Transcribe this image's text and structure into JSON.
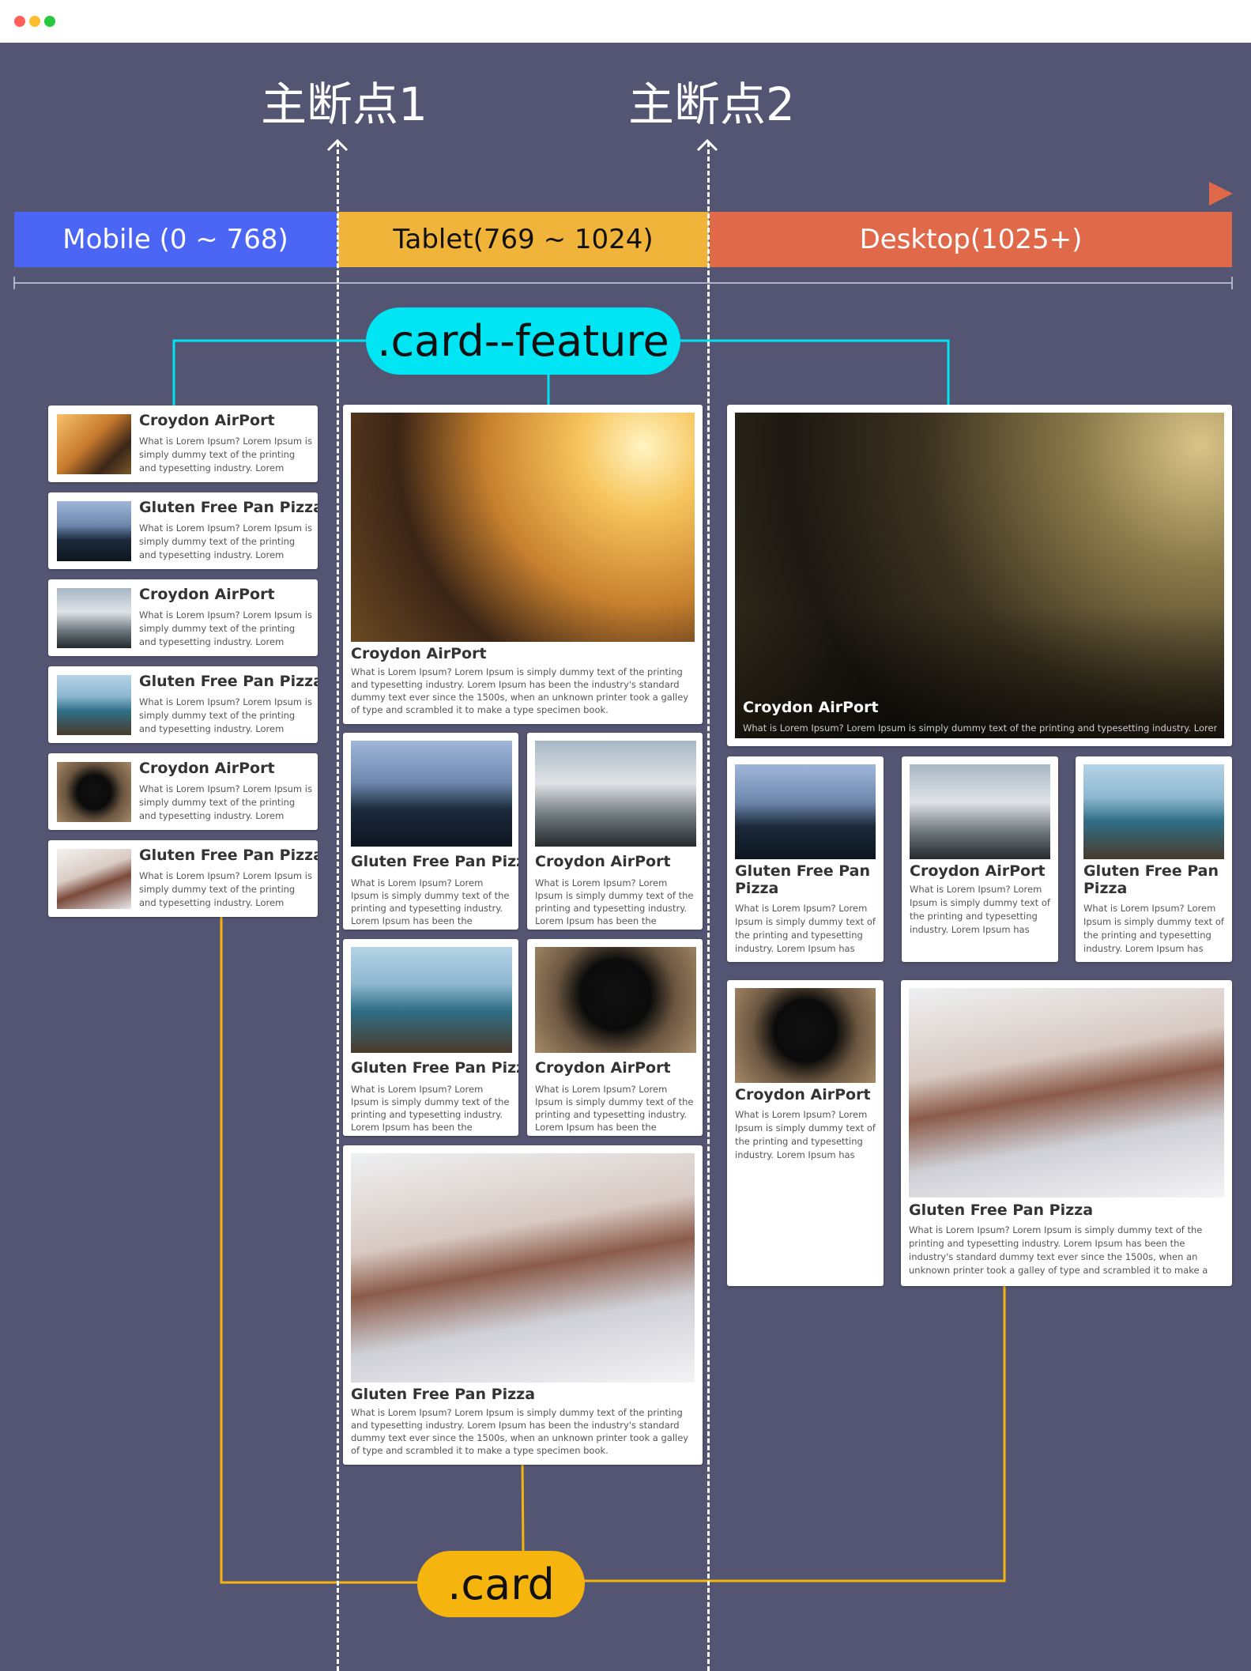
{
  "window": {
    "controls": [
      "close",
      "minimize",
      "maximize"
    ]
  },
  "breakpoints": {
    "bp1": "主断点1",
    "bp2": "主断点2"
  },
  "segments": {
    "mobile": "Mobile (0 ~ 768)",
    "tablet": "Tablet(769 ~ 1024)",
    "desktop": "Desktop(1025+)"
  },
  "labels": {
    "feature": ".card--feature",
    "card": ".card"
  },
  "colors": {
    "background": "#545573",
    "mobile": "#4b66f5",
    "tablet": "#f0b43b",
    "desktop": "#e0694a",
    "feature": "#00e5f4",
    "card": "#f6b40e"
  },
  "text": {
    "short": "What is Lorem Ipsum? Lorem Ipsum is simply dummy text of the printing and typesetting industry. Lorem Ipsum has been the industry's standard dummy text ever since the 1500s.",
    "long": "What is Lorem Ipsum? Lorem Ipsum is simply dummy text of the printing and typesetting industry. Lorem Ipsum has been the industry's standard dummy text ever since the 1500s, when an unknown printer took a galley of type and scrambled it to make a type specimen book.",
    "oneline": "What is Lorem Ipsum? Lorem Ipsum is simply dummy text of the printing and typesetting industry. Lorem Ipsum has..."
  },
  "cards": {
    "croydon": "Croydon AirPort",
    "gluten": "Gluten Free Pan Pizza"
  },
  "photos": [
    "girl-in-field",
    "forest-trees",
    "misty-mountains",
    "rocky-coast",
    "black-dog",
    "mixing-console"
  ]
}
